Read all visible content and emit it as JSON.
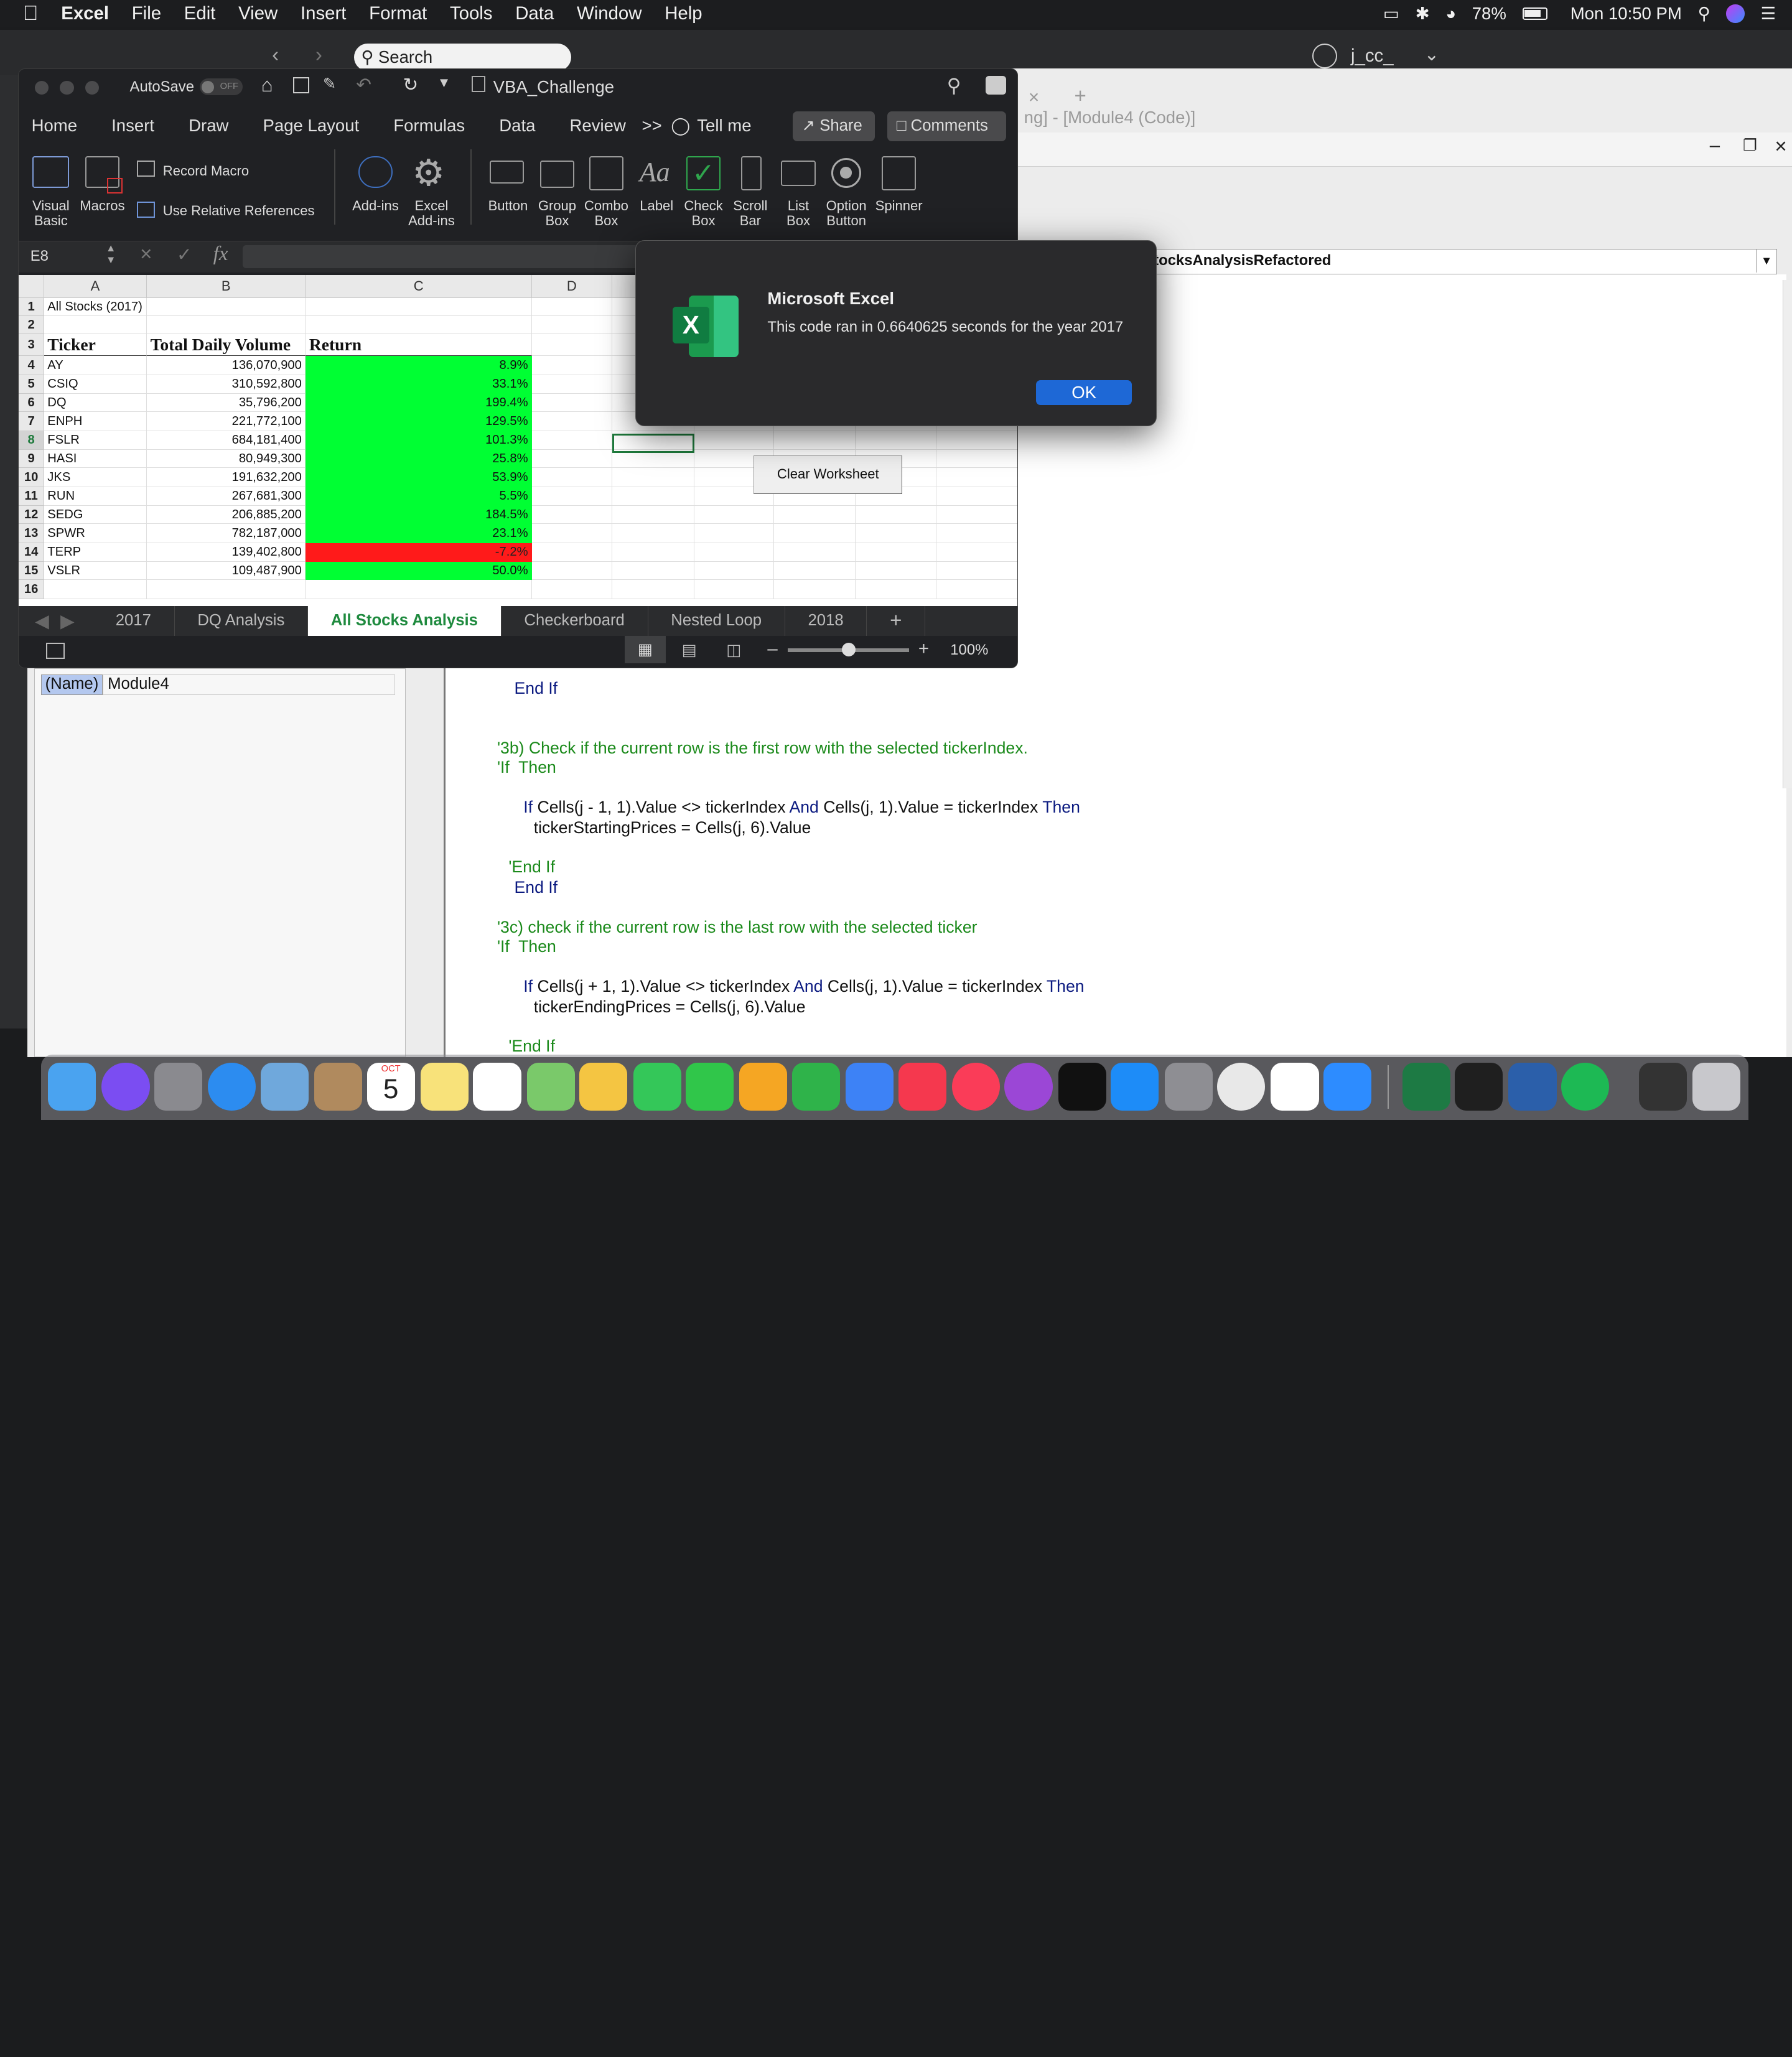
{
  "menubar": {
    "app": "Excel",
    "items": [
      "File",
      "Edit",
      "View",
      "Insert",
      "Format",
      "Tools",
      "Data",
      "Window",
      "Help"
    ],
    "battery": "78%",
    "clock": "Mon 10:50 PM"
  },
  "background": {
    "search_placeholder": "Search",
    "user": "j_cc_"
  },
  "excel": {
    "autosave_label": "AutoSave",
    "autosave_state": "OFF",
    "file_name": "VBA_Challenge",
    "tabs": [
      "Home",
      "Insert",
      "Draw",
      "Page Layout",
      "Formulas",
      "Data",
      "Review"
    ],
    "more_tabs": ">>",
    "tell_me": "Tell me",
    "share": "Share",
    "comments": "Comments",
    "ribbon": {
      "visual_basic": [
        "Visual",
        "Basic"
      ],
      "macros": "Macros",
      "record_macro": "Record Macro",
      "relative_refs": "Use Relative References",
      "addins": "Add-ins",
      "excel_addins": [
        "Excel",
        "Add-ins"
      ],
      "button": "Button",
      "group_box": [
        "Group",
        "Box"
      ],
      "combo_box": [
        "Combo",
        "Box"
      ],
      "label": "Label",
      "check_box": [
        "Check",
        "Box"
      ],
      "scroll_bar": [
        "Scroll",
        "Bar"
      ],
      "list_box": [
        "List",
        "Box"
      ],
      "option_button": [
        "Option",
        "Button"
      ],
      "spinner": "Spinner"
    },
    "name_box": "E8",
    "fx": "fx",
    "columns": [
      "A",
      "B",
      "C",
      "D"
    ],
    "cell_a1": "All Stocks (2017)",
    "headers": [
      "Ticker",
      "Total Daily Volume",
      "Return"
    ],
    "rows": [
      {
        "ticker": "AY",
        "volume": "136,070,900",
        "ret": "8.9%",
        "positive": true
      },
      {
        "ticker": "CSIQ",
        "volume": "310,592,800",
        "ret": "33.1%",
        "positive": true
      },
      {
        "ticker": "DQ",
        "volume": "35,796,200",
        "ret": "199.4%",
        "positive": true
      },
      {
        "ticker": "ENPH",
        "volume": "221,772,100",
        "ret": "129.5%",
        "positive": true
      },
      {
        "ticker": "FSLR",
        "volume": "684,181,400",
        "ret": "101.3%",
        "positive": true
      },
      {
        "ticker": "HASI",
        "volume": "80,949,300",
        "ret": "25.8%",
        "positive": true
      },
      {
        "ticker": "JKS",
        "volume": "191,632,200",
        "ret": "53.9%",
        "positive": true
      },
      {
        "ticker": "RUN",
        "volume": "267,681,300",
        "ret": "5.5%",
        "positive": true
      },
      {
        "ticker": "SEDG",
        "volume": "206,885,200",
        "ret": "184.5%",
        "positive": true
      },
      {
        "ticker": "SPWR",
        "volume": "782,187,000",
        "ret": "23.1%",
        "positive": true
      },
      {
        "ticker": "TERP",
        "volume": "139,402,800",
        "ret": "-7.2%",
        "positive": false
      },
      {
        "ticker": "VSLR",
        "volume": "109,487,900",
        "ret": "50.0%",
        "positive": true
      }
    ],
    "row_numbers": [
      "1",
      "2",
      "3",
      "4",
      "5",
      "6",
      "7",
      "8",
      "9",
      "10",
      "11",
      "12",
      "13",
      "14",
      "15",
      "16"
    ],
    "clear_button": "Clear Worksheet",
    "sheet_tabs": [
      "2017",
      "DQ Analysis",
      "All Stocks Analysis",
      "Checkerboard",
      "Nested Loop",
      "2018"
    ],
    "active_sheet": "All Stocks Analysis",
    "add_sheet": "+",
    "zoom": "100%"
  },
  "dialog": {
    "title": "Microsoft Excel",
    "message": "This code ran in 0.6640625 seconds for the year 2017",
    "ok": "OK"
  },
  "vbe": {
    "title": "ng] - [Module4 (Code)]",
    "procedure": "tocksAnalysisRefactored",
    "prop_name_key": "(Name)",
    "prop_name_val": "Module4",
    "code": {
      "l1": "End If",
      "c3b": "'3b) Check if the current row is the first row with the selected tickerIndex.",
      "c3b2": "'If  Then",
      "if1a": "If",
      "if1b": " Cells(j - 1, 1).Value <> tickerIndex ",
      "if1c": "And",
      "if1d": " Cells(j, 1).Value = tickerIndex ",
      "if1e": "Then",
      "start": "tickerStartingPrices = Cells(j, 6).Value",
      "cEndIf": "'End If",
      "endif2": "End If",
      "c3c": "'3c) check if the current row is the last row with the selected ticker",
      "c3c2": "'If  Then",
      "if2b": " Cells(j + 1, 1).Value <> tickerIndex ",
      "if2d": " Cells(j, 1).Value = tickerIndex ",
      "end": "tickerEndingPrices = Cells(j, 6).Value",
      "cEndIf2": "'End If"
    }
  },
  "dock": {
    "calendar_month": "OCT",
    "calendar_day": "5"
  },
  "colors": {
    "positive": "#00ff33",
    "negative": "#ff1a1a",
    "ok_blue": "#1e68d6",
    "excel_green": "#1e8a3e"
  }
}
